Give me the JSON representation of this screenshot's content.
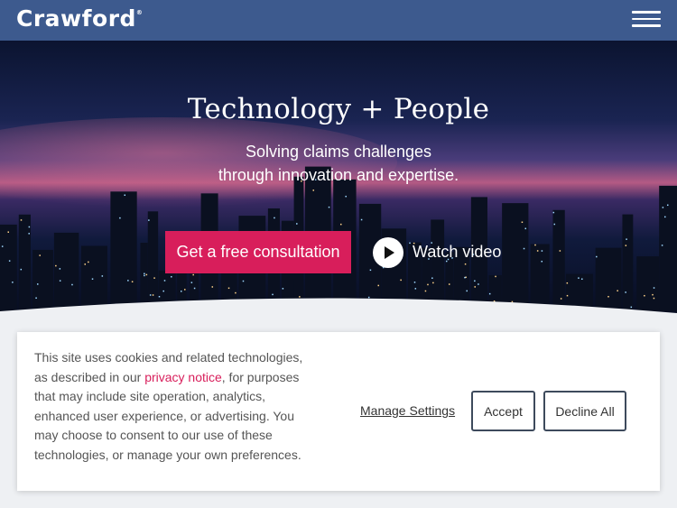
{
  "header": {
    "logo_text": "Crawford",
    "logo_mark": "®",
    "menu_icon": "hamburger-menu-icon"
  },
  "hero": {
    "title": "Technology + People",
    "subtitle_line1": "Solving claims challenges",
    "subtitle_line2": "through innovation and expertise.",
    "cta_label": "Get a free consultation",
    "watch_label": "Watch video",
    "play_icon": "play-icon"
  },
  "cookie_banner": {
    "text_before_link": "This site uses cookies and related technologies, as described in our ",
    "link_text": "privacy notice",
    "text_after_link": ", for purposes that may include site operation, analytics, enhanced user experience, or advertising. You may choose to consent to our use of these technologies, or manage your own preferences.",
    "manage_label": "Manage Settings",
    "accept_label": "Accept",
    "decline_label": "Decline All"
  },
  "colors": {
    "nav": "#3d5a8e",
    "accent": "#d81e5b",
    "white": "#ffffff"
  }
}
